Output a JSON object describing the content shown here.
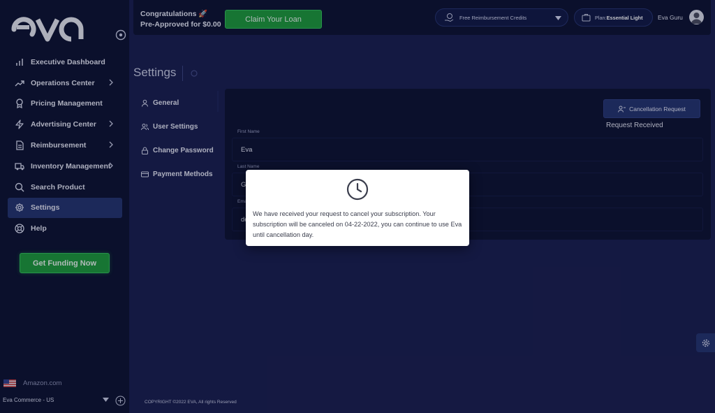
{
  "sidebar": {
    "logo_text": "eva",
    "items": [
      {
        "label": "Executive Dashboard",
        "icon": "bar-chart-icon",
        "has_chevron": false
      },
      {
        "label": "Operations Center",
        "icon": "trend-up-icon",
        "has_chevron": true
      },
      {
        "label": "Pricing Management",
        "icon": "award-icon",
        "has_chevron": false
      },
      {
        "label": "Advertising Center",
        "icon": "lightning-icon",
        "has_chevron": true
      },
      {
        "label": "Reimbursement",
        "icon": "document-icon",
        "has_chevron": true
      },
      {
        "label": "Inventory Management",
        "icon": "truck-icon",
        "has_chevron": true
      },
      {
        "label": "Search Product",
        "icon": "search-icon",
        "has_chevron": false
      },
      {
        "label": "Settings",
        "icon": "gear-icon",
        "has_chevron": false,
        "active": true
      },
      {
        "label": "Help",
        "icon": "lifebuoy-icon",
        "has_chevron": false
      }
    ],
    "funding_button": "Get Funding Now",
    "store": "Amazon.com",
    "account": "Eva Commerce - US"
  },
  "topbar": {
    "congrats_line1": "Congratulations",
    "congrats_line2": "Pre-Approved for $0.00",
    "claim_button": "Claim Your Loan",
    "credits_label": "Free Reimbursement Credits",
    "plan_prefix": "Plan: ",
    "plan_name": "Essential Light",
    "user_name": "Eva Guru"
  },
  "settings": {
    "title": "Settings",
    "subnav": [
      {
        "label": "General",
        "icon": "user-icon"
      },
      {
        "label": "User Settings",
        "icon": "users-icon"
      },
      {
        "label": "Change Password",
        "icon": "lock-icon"
      },
      {
        "label": "Payment Methods",
        "icon": "credit-card-icon"
      }
    ],
    "cancel_button": "Cancellation Request",
    "status": "Request Received",
    "fields": [
      {
        "label": "First Name",
        "value": "Eva"
      },
      {
        "label": "Last Name",
        "value": "Guru"
      },
      {
        "label": "Email",
        "value": "demo@eva.guru"
      }
    ]
  },
  "modal": {
    "message": "We have received your request to cancel your subscription. Your subscription will be canceled on 04-22-2022, you can continue to use Eva until cancellation day."
  },
  "footer": "COPYRIGHT ©2022 EVA, All rights Reserved",
  "colors": {
    "background": "#1a1f4e",
    "sidebar": "#0e1330",
    "active": "#25346e",
    "green": "#1e9a3a"
  }
}
